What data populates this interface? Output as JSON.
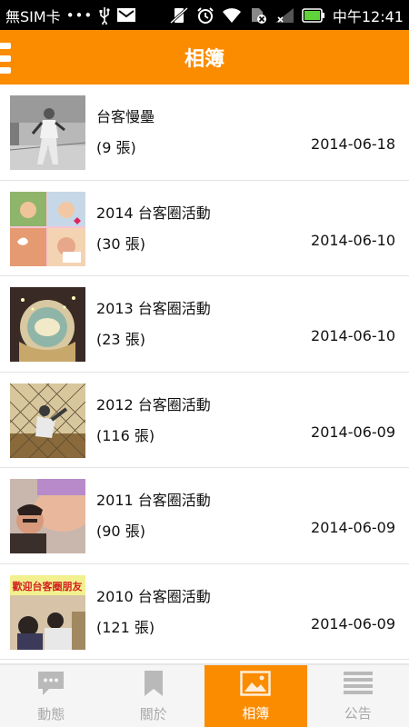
{
  "status_bar": {
    "carrier": "無SIM卡",
    "dots": "•••",
    "time": "中午12:41"
  },
  "header": {
    "title": "相簿"
  },
  "albums": [
    {
      "name": "台客慢壘",
      "count": "(9 張)",
      "date": "2014-06-18"
    },
    {
      "name": "2014 台客圈活動",
      "count": "(30 張)",
      "date": "2014-06-10"
    },
    {
      "name": "2013 台客圈活動",
      "count": "(23 張)",
      "date": "2014-06-10"
    },
    {
      "name": "2012 台客圈活動",
      "count": "(116 張)",
      "date": "2014-06-09"
    },
    {
      "name": "2011 台客圈活動",
      "count": "(90 張)",
      "date": "2014-06-09"
    },
    {
      "name": "2010 台客圈活動",
      "count": "(121 張)",
      "date": "2014-06-09"
    }
  ],
  "album_thumb_texts": {
    "thumb6_banner": "歡迎台客圈朋友"
  },
  "tabs": [
    {
      "label": "動態",
      "icon": "chat-bubble-icon",
      "active": false
    },
    {
      "label": "關於",
      "icon": "bookmark-icon",
      "active": false
    },
    {
      "label": "相簿",
      "icon": "photo-icon",
      "active": true
    },
    {
      "label": "公告",
      "icon": "list-icon",
      "active": false
    }
  ],
  "colors": {
    "accent": "#fb8c00",
    "tab_inactive": "#a9a9a9"
  }
}
